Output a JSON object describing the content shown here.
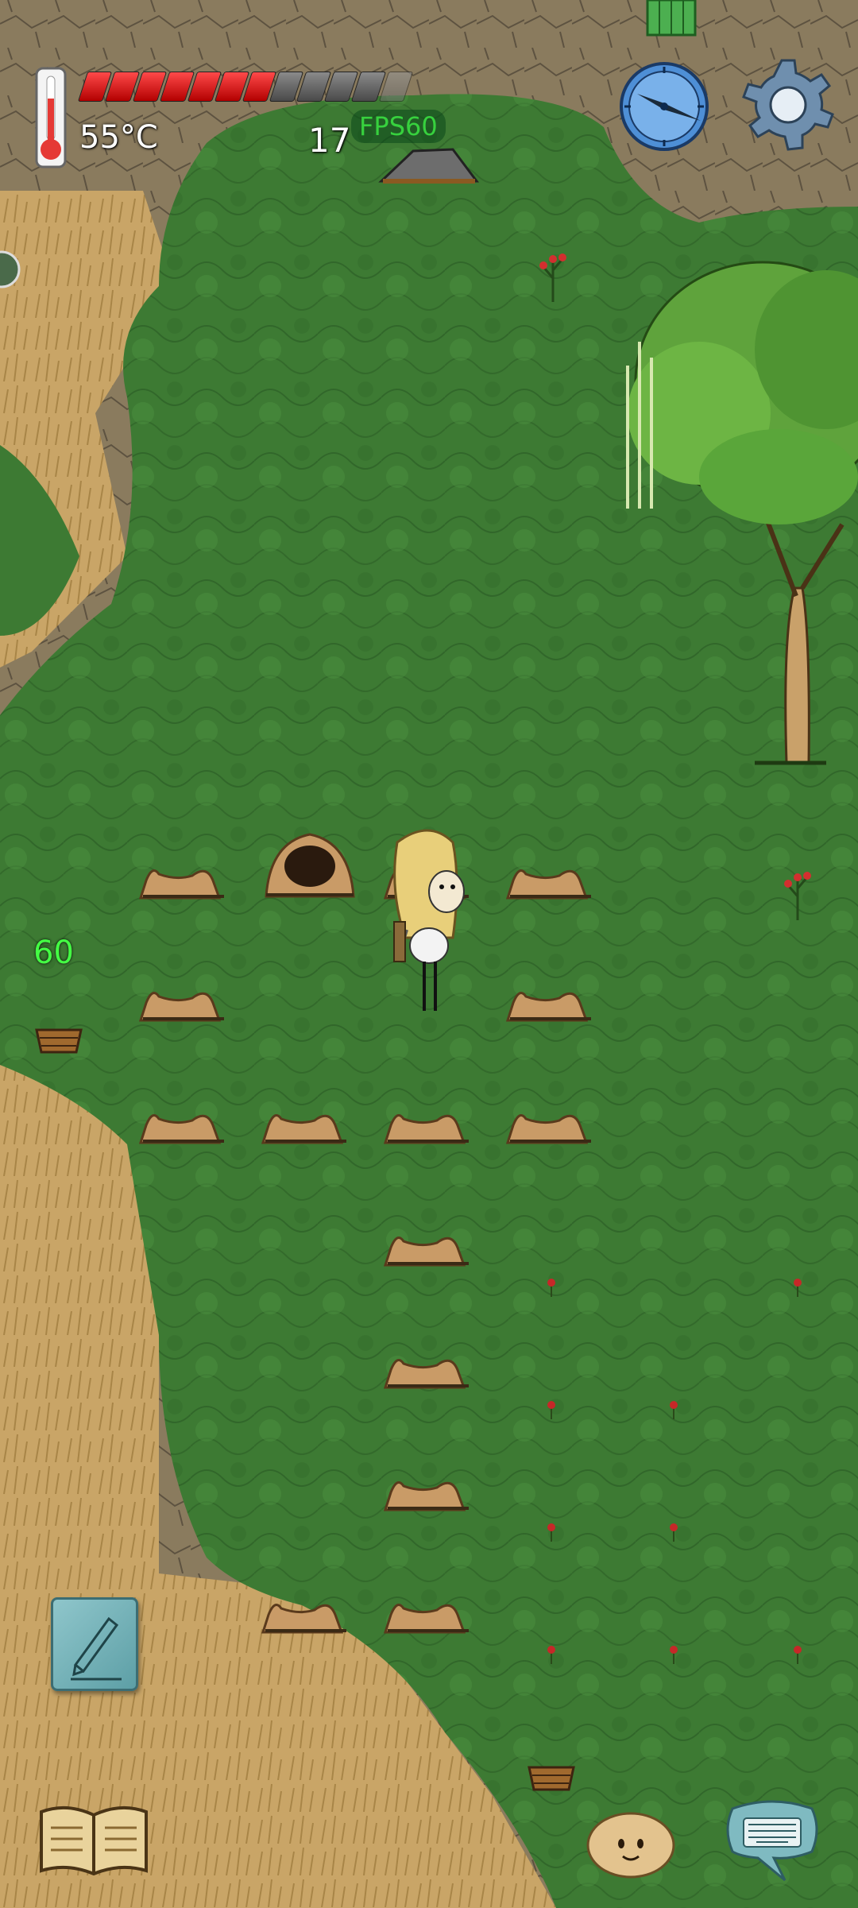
{
  "hud": {
    "temperature": "55°C",
    "hunger": {
      "filled": 7,
      "total": 12
    },
    "age": "17",
    "fps": "FPS60",
    "side_counter": "60"
  },
  "icons": {
    "thermometer": "thermometer-icon",
    "compass": "compass-icon",
    "settings": "gear-icon",
    "pencil": "pencil-icon",
    "book": "open-book-icon",
    "emote": "face-icon",
    "chat": "keyboard-chat-icon"
  },
  "colors": {
    "grass": "#3f7a34",
    "dry_grass": "#c9a567",
    "dirt": "#8b7b5f",
    "hunger_on": "#e02020",
    "fps": "#37d13e",
    "side_counter": "#44ff44"
  }
}
